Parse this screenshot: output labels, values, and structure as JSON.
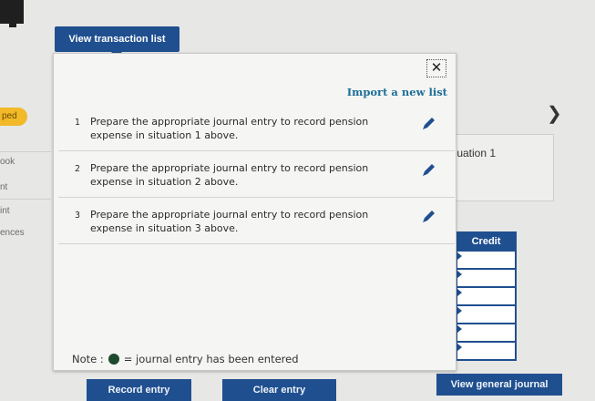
{
  "header": {
    "view_list_label": "View transaction list"
  },
  "side_nav": [
    "ped",
    "ook",
    "nt",
    "int",
    "ences"
  ],
  "popup": {
    "import_label": "Import a new list",
    "close_label": "✕",
    "entries": [
      {
        "num": "1",
        "text": "Prepare the appropriate journal entry to record pension expense in situation 1 above."
      },
      {
        "num": "2",
        "text": "Prepare the appropriate journal entry to record pension expense in situation 2 above."
      },
      {
        "num": "3",
        "text": "Prepare the appropriate journal entry to record pension expense in situation 3 above."
      }
    ],
    "note_prefix": "Note :",
    "note_suffix": "= journal entry has been entered"
  },
  "background": {
    "situation_label": ":uation 1",
    "credit_header": "Credit"
  },
  "buttons": {
    "record": "Record entry",
    "clear": "Clear entry",
    "view_journal": "View general journal"
  },
  "colors": {
    "primary": "#1f4f8f",
    "link": "#1c6e96",
    "badge": "#f2b928",
    "entered_dot": "#1d4a2d"
  }
}
